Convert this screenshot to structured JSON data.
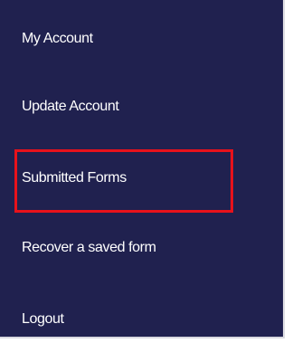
{
  "menu": {
    "items": [
      {
        "label": "My Account"
      },
      {
        "label": "Update Account"
      },
      {
        "label": "Submitted Forms"
      },
      {
        "label": "Recover a saved form"
      },
      {
        "label": "Logout"
      }
    ],
    "highlighted_item": "Submitted Forms"
  },
  "colors": {
    "background": "#20214f",
    "text": "#ffffff",
    "highlight": "#e8121b"
  }
}
